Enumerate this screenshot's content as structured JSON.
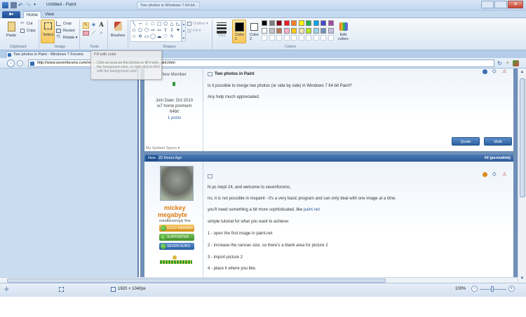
{
  "window": {
    "title": "Untitled - Paint",
    "taskbar_tab": "Two photos in Windows 7 64 bit..."
  },
  "ribbon": {
    "file_tab": "■▾",
    "tabs": [
      "Home",
      "View"
    ],
    "clipboard": {
      "paste": "Paste",
      "cut": "Cut",
      "copy": "Copy",
      "label": "Clipboard"
    },
    "image": {
      "select": "Select",
      "crop": "Crop",
      "resize": "Resize",
      "rotate": "Rotate ▾",
      "label": "Image"
    },
    "tools": {
      "label": "Tools",
      "text_tool": "A"
    },
    "brushes": {
      "label": "Brushes"
    },
    "shapes": {
      "outline": "Outline ▾",
      "fill": "Fill ▾",
      "label": "Shapes"
    },
    "size": {
      "label": "Size"
    },
    "color1": {
      "label": "Color\n1",
      "value": "#000000"
    },
    "color2": {
      "label": "Color\n2",
      "value": "#ffffff"
    },
    "colors_label": "Colors",
    "edit_colors": "Edit\ncolors",
    "palette_row1": [
      "#000000",
      "#7f7f7f",
      "#880015",
      "#ed1c24",
      "#ff7f27",
      "#fff200",
      "#22b14c",
      "#00a2e8",
      "#3f48cc",
      "#a349a4"
    ],
    "palette_row2": [
      "#ffffff",
      "#c3c3c3",
      "#b97a57",
      "#ffaec9",
      "#ffc90e",
      "#efe4b0",
      "#b5e61d",
      "#99d9ea",
      "#7092be",
      "#c8bfe7"
    ],
    "palette_row3": [
      "#ffffff",
      "#ffffff",
      "#ffffff",
      "#ffffff",
      "#ffffff",
      "#ffffff",
      "#ffffff",
      "#ffffff",
      "#ffffff",
      "#ffffff"
    ]
  },
  "browser": {
    "tab_title": "Two photos in Paint - Windows 7 Forums",
    "url": "http://www.sevenforums.com/music-pictures-video/168739-two-photos-paint.html"
  },
  "tooltip": {
    "title": "Fill with color",
    "body": "Click an area on the canvas to fill it with the foreground color, or right-click to fill it with the background color."
  },
  "post1": {
    "user_rank": "New Member",
    "join_date": "Join Date: Oct 2010",
    "os": "w7 home premium",
    "bits": "64bit",
    "posts": "1 posts",
    "title": "Two photos in Paint",
    "body": [
      "Is it possible to merge two photos (or side by side) in Windows 7 64 bit Paint?",
      "Any help much appreciated."
    ],
    "quote": "Quote",
    "multi": "Multi",
    "system_specs": "My System Specs ▾"
  },
  "post2": {
    "badge": "New",
    "time": "22 Hours Ago",
    "permalink": "#2 (permalink)",
    "username_1": "mickey",
    "username_2": "megabyte",
    "tagline": "mindblowingly fine",
    "badges": [
      "GOLD MEMBER",
      "SUPPORTER",
      "SEVEN GURU"
    ],
    "lines": [
      "hi pc inept 24, and welcome to sevenforums,",
      "no, it is not possible in mspaint - it's a very basic program and can only deal with one image at a time.",
      "you'll need something a bit more sophisticated, like",
      "simple tutorial for what you want to achieve:",
      "1 - open the first image in paint.net",
      "2 - increase the canvas size, so there's a blank area for picture 2",
      "3 - import picture 2",
      "4 - place it where you like."
    ],
    "link": "paint.net"
  },
  "statusbar": {
    "dimensions": "1920 × 1040px",
    "zoom": "100%"
  }
}
